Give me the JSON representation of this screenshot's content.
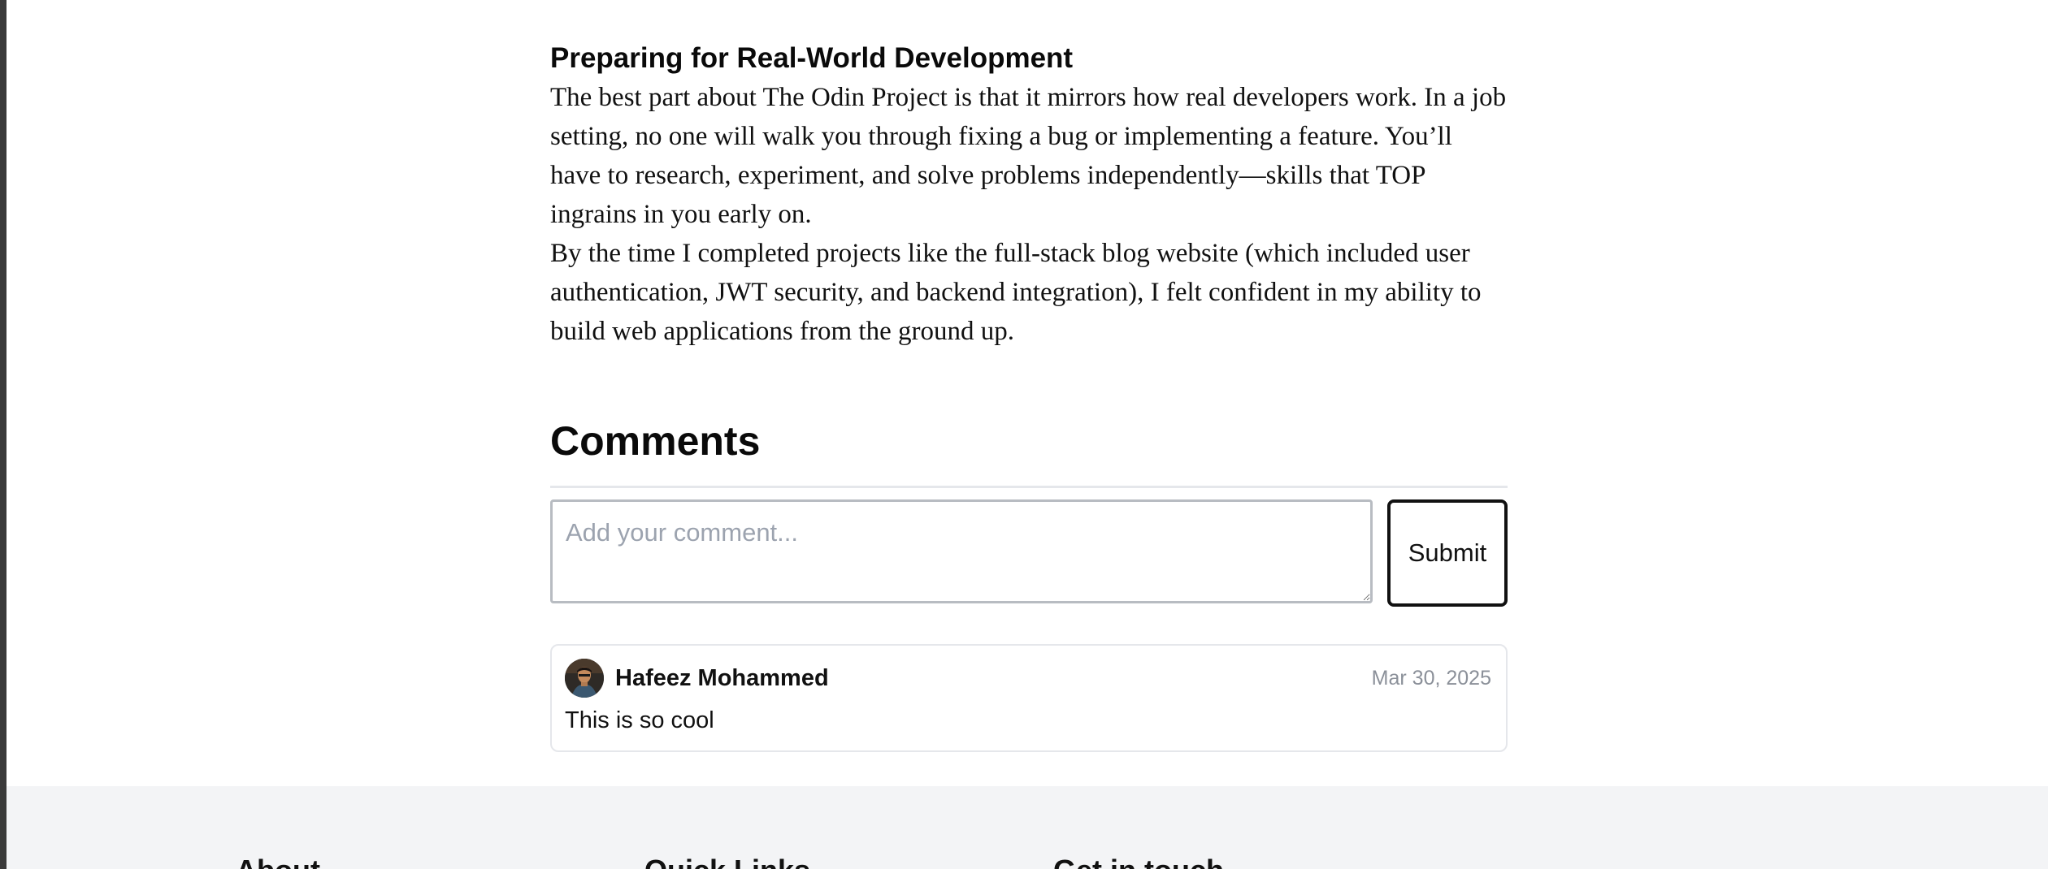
{
  "article": {
    "heading": "Preparing for Real-World Development",
    "paragraphs": [
      "The best part about The Odin Project is that it mirrors how real developers work. In a job setting, no one will walk you through fixing a bug or implementing a feature. You’ll have to research, experiment, and solve problems independently—skills that TOP ingrains in you early on.",
      "By the time I completed projects like the full-stack blog website (which included user authentication, JWT security, and backend integration), I felt confident in my ability to build web applications from the ground up."
    ]
  },
  "comments": {
    "title": "Comments",
    "input_placeholder": "Add your comment...",
    "input_value": "",
    "submit_label": "Submit",
    "items": [
      {
        "author": "Hafeez Mohammed",
        "date": "Mar 30, 2025",
        "text": "This is so cool",
        "avatar_icon": "user-avatar-photo"
      }
    ]
  },
  "footer": {
    "columns": [
      "About",
      "Quick Links",
      "Get in touch"
    ]
  },
  "colors": {
    "footer_bg": "#f3f4f6",
    "divider": "#e5e7eb",
    "muted_text": "#8b9099",
    "button_border": "#111111"
  }
}
